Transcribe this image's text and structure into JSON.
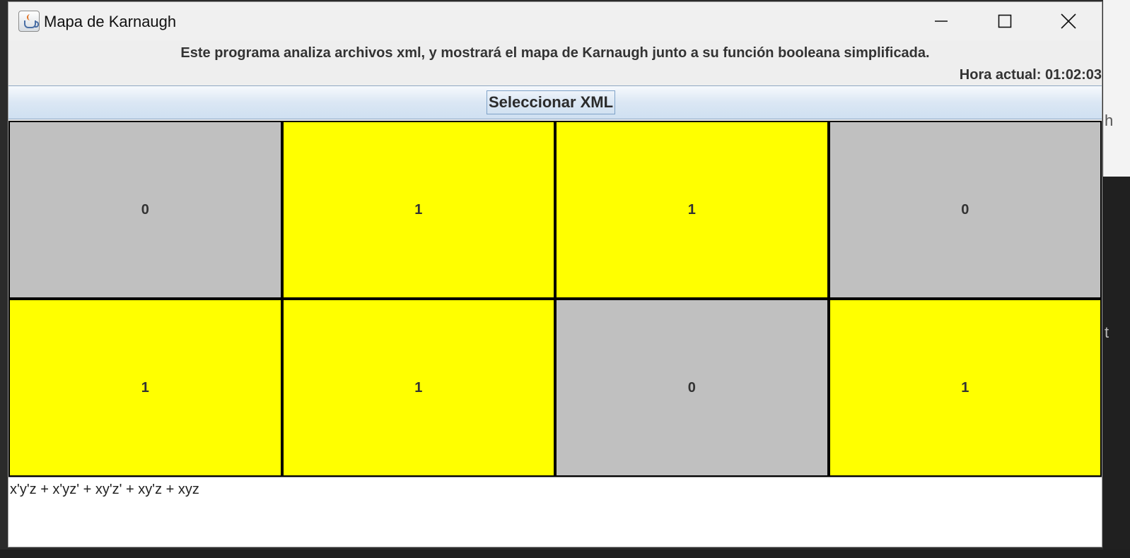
{
  "window": {
    "title": "Mapa de Karnaugh"
  },
  "header": {
    "description": "Este programa analiza archivos xml, y mostrará el mapa de Karnaugh junto a su función booleana simplificada.",
    "clock": "Hora actual: 01:02:03"
  },
  "toolbar": {
    "select_label": "Seleccionar XML"
  },
  "kmap": {
    "rows": [
      [
        "0",
        "1",
        "1",
        "0"
      ],
      [
        "1",
        "1",
        "0",
        "1"
      ]
    ],
    "colors": {
      "one": "#ffff00",
      "zero": "#c0c0c0",
      "border": "#000000"
    }
  },
  "result": {
    "expression": "x'y'z + x'yz' + xy'z' + xy'z + xyz"
  },
  "backdrop": {
    "right_glyphs": [
      "h",
      "t"
    ]
  },
  "icons": {
    "app": "java-icon",
    "minimize": "minimize-icon",
    "maximize": "maximize-icon",
    "close": "close-icon"
  }
}
